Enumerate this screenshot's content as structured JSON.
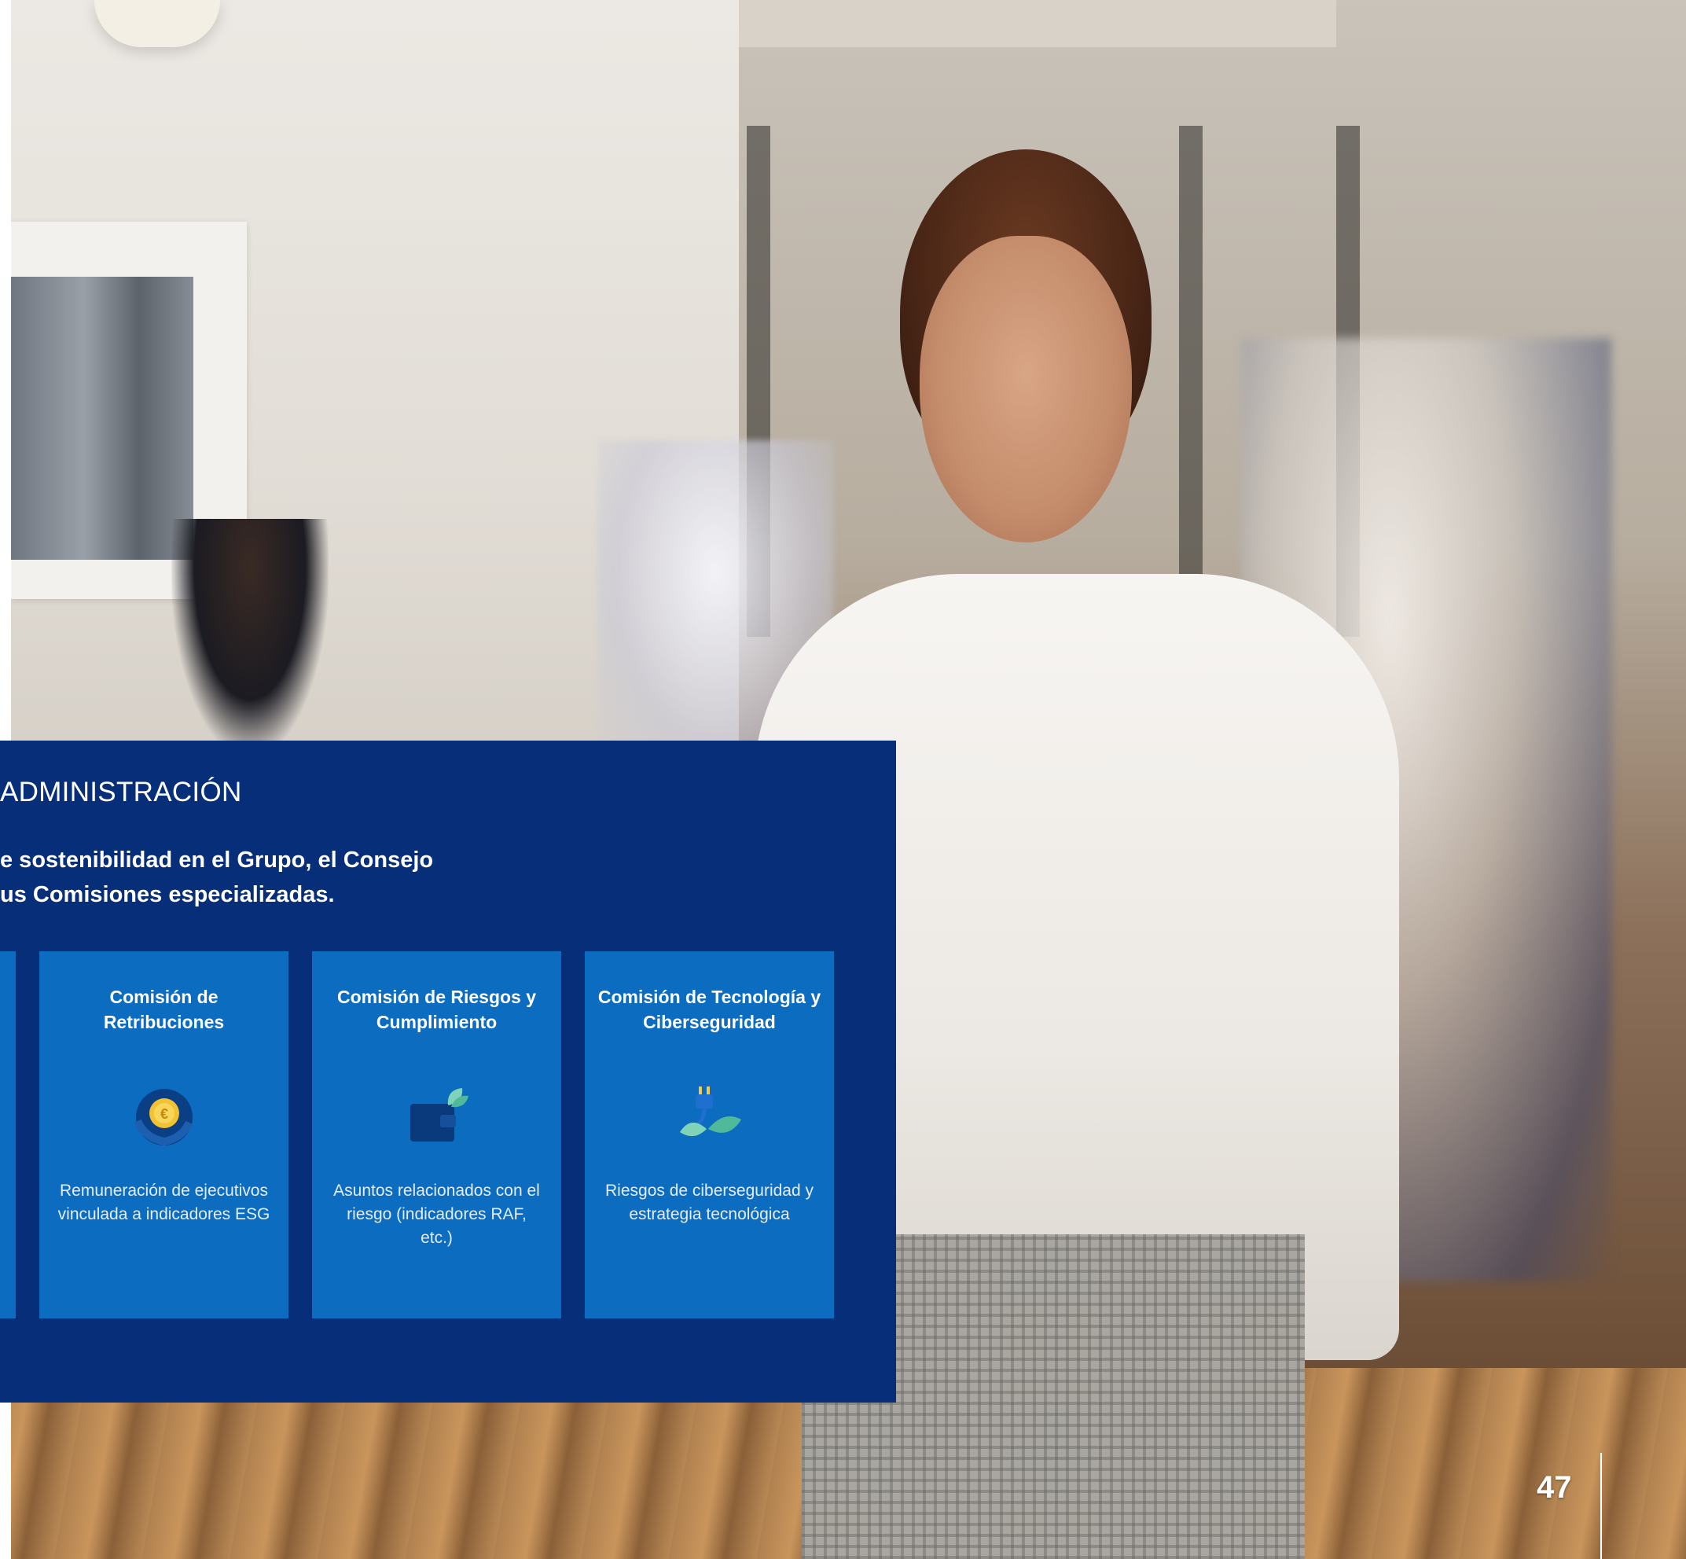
{
  "panel": {
    "title": "ADMINISTRACIÓN",
    "intro_line1": "e sostenibilidad en el Grupo, el Consejo",
    "intro_line2": "us Comisiones especializadas."
  },
  "cards": [
    {
      "title": "Comisión de Retribuciones",
      "icon": "coin-hand-icon",
      "description": "Remuneración de ejecutivos vinculada a indicadores ESG"
    },
    {
      "title": "Comisión de Riesgos y Cumplimiento",
      "icon": "wallet-leaf-icon",
      "description": "Asuntos relacionados con el riesgo (indicadores RAF, etc.)"
    },
    {
      "title": "Comisión de Tecnología y Ciberseguridad",
      "icon": "plug-leaf-icon",
      "description": "Riesgos de ciberseguridad y estrategia tecnológica"
    }
  ],
  "page": {
    "number": "47"
  },
  "colors": {
    "panel": "#072f79",
    "card": "#0c6dc0"
  }
}
